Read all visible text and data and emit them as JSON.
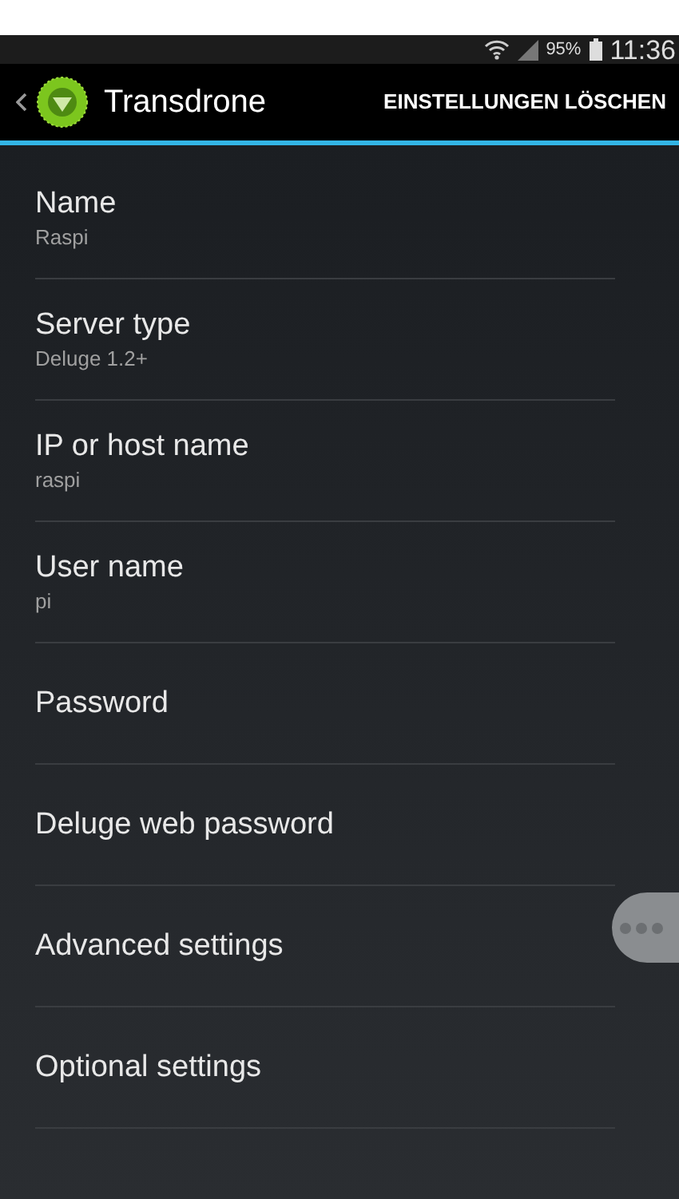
{
  "status_bar": {
    "battery": "95%",
    "time": "11:36"
  },
  "action_bar": {
    "title": "Transdrone",
    "action": "EINSTELLUNGEN LÖSCHEN"
  },
  "settings": [
    {
      "title": "Name",
      "summary": "Raspi"
    },
    {
      "title": "Server type",
      "summary": "Deluge 1.2+"
    },
    {
      "title": "IP or host name",
      "summary": "raspi"
    },
    {
      "title": "User name",
      "summary": "pi"
    },
    {
      "title": "Password"
    },
    {
      "title": "Deluge web password"
    },
    {
      "title": "Advanced settings"
    },
    {
      "title": "Optional settings"
    }
  ]
}
